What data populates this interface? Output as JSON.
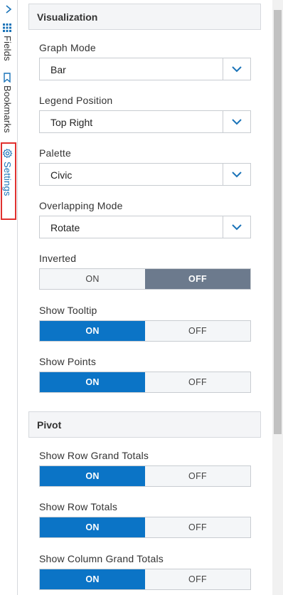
{
  "rail": {
    "tabs": [
      {
        "label": "Fields",
        "icon": "grid-icon"
      },
      {
        "label": "Bookmarks",
        "icon": "bookmark-icon"
      },
      {
        "label": "Settings",
        "icon": "gear-icon"
      }
    ]
  },
  "visualization": {
    "title": "Visualization",
    "graph_mode": {
      "label": "Graph Mode",
      "value": "Bar"
    },
    "legend_position": {
      "label": "Legend Position",
      "value": "Top Right"
    },
    "palette": {
      "label": "Palette",
      "value": "Civic"
    },
    "overlapping_mode": {
      "label": "Overlapping Mode",
      "value": "Rotate"
    },
    "inverted": {
      "label": "Inverted",
      "on": "ON",
      "off": "OFF",
      "state": "OFF"
    },
    "show_tooltip": {
      "label": "Show Tooltip",
      "on": "ON",
      "off": "OFF",
      "state": "ON"
    },
    "show_points": {
      "label": "Show Points",
      "on": "ON",
      "off": "OFF",
      "state": "ON"
    }
  },
  "pivot": {
    "title": "Pivot",
    "show_row_grand_totals": {
      "label": "Show Row Grand Totals",
      "on": "ON",
      "off": "OFF",
      "state": "ON"
    },
    "show_row_totals": {
      "label": "Show Row Totals",
      "on": "ON",
      "off": "OFF",
      "state": "ON"
    },
    "show_column_grand_totals": {
      "label": "Show Column Grand Totals",
      "on": "ON",
      "off": "OFF",
      "state": "ON"
    }
  },
  "colors": {
    "accent": "#0b74c6",
    "off_active": "#6c7a8d",
    "highlight": "#e0312f"
  }
}
